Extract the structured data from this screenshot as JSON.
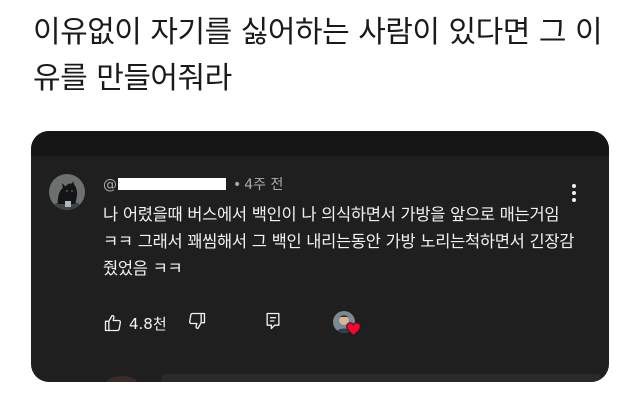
{
  "post": {
    "title": "이유없이 자기를 싫어하는 사람이 있다면 그 이유를 만들어줘라"
  },
  "comment": {
    "username_prefix": "@",
    "username_suffix": "",
    "separator": "•",
    "timestamp": "4주 전",
    "text": "나 어렸을때 버스에서 백인이 나 의식하면서 가방을 앞으로 매는거임 ㅋㅋ 그래서 꽤씸해서 그 백인 내리는동안 가방 노리는척하면서 긴장감 줬었음 ㅋㅋ",
    "like_count": "4.8천",
    "icons": {
      "like": "thumbs-up-icon",
      "dislike": "thumbs-down-icon",
      "reply": "reply-icon",
      "more": "more-vert-icon",
      "heart": "heart-icon"
    }
  },
  "colors": {
    "card_background": "#1f1f1f",
    "comment_text": "#f1f1f1",
    "meta_text": "#aaaaaa",
    "heart": "#ff0033"
  }
}
